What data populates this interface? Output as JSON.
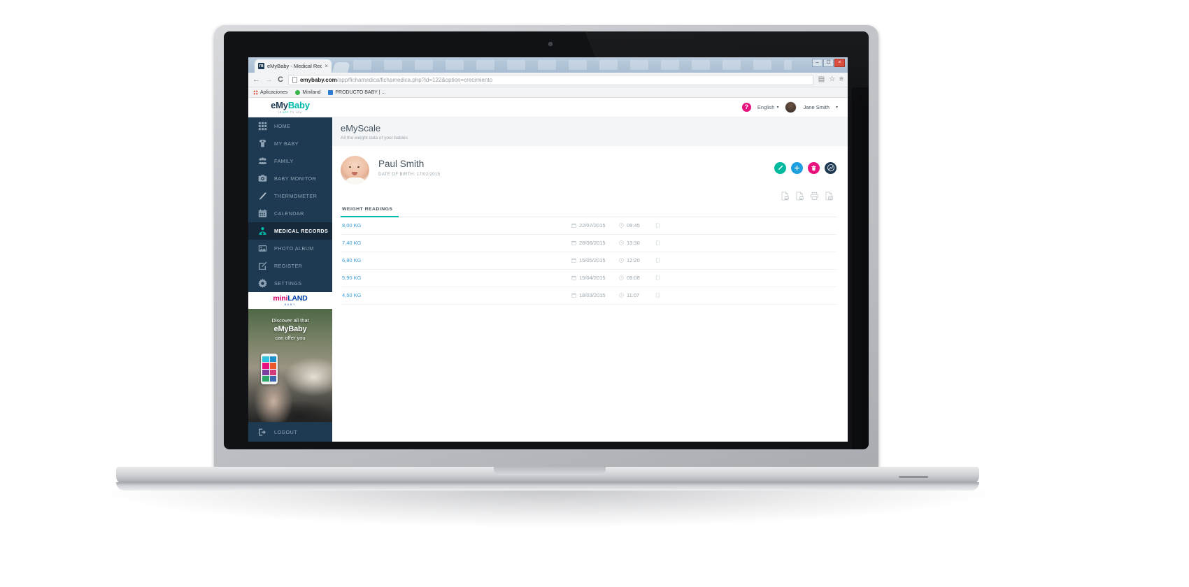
{
  "browser": {
    "tab": {
      "title": "eMyBaby - Medical Reco",
      "favicon": "m",
      "close": "×"
    },
    "window_controls": {
      "minimize": "–",
      "maximize": "☐",
      "close": "×"
    },
    "nav": {
      "back": "←",
      "forward": "→",
      "reload": "C"
    },
    "omnibox": {
      "domain": "emybaby.com",
      "path": "/app/fichamedica/fichamedica.php?id=122&option=crecimiento"
    },
    "toolbar_right": {
      "star": "☆",
      "extension": "▤",
      "menu": "≡"
    },
    "bookmarks": [
      {
        "label": "Aplicaciones",
        "icon": "apps-grid-icon"
      },
      {
        "label": "Miniland",
        "icon": "miniland-icon"
      },
      {
        "label": "PRODUCTO BABY | ...",
        "icon": "document-icon"
      }
    ]
  },
  "app": {
    "brand": {
      "name_a": "eMy",
      "name_b": "Baby",
      "tagline_a": "IS ",
      "tagline_b": "APP",
      "tagline_c": " TO YOU"
    },
    "topbar": {
      "help": "?",
      "language": "English",
      "caret": "▾",
      "user_name": "Jane Smith"
    },
    "sidebar": {
      "items": [
        {
          "label": "HOME",
          "icon": "grid-icon",
          "active": false
        },
        {
          "label": "MY BABY",
          "icon": "onesie-icon",
          "active": false
        },
        {
          "label": "FAMILY",
          "icon": "people-icon",
          "active": false
        },
        {
          "label": "BABY MONITOR",
          "icon": "camera-icon",
          "active": false
        },
        {
          "label": "THERMOMETER",
          "icon": "thermometer-icon",
          "active": false
        },
        {
          "label": "CALENDAR",
          "icon": "calendar-icon",
          "active": false
        },
        {
          "label": "MEDICAL RECORDS",
          "icon": "doctor-icon",
          "active": true
        },
        {
          "label": "PHOTO ALBUM",
          "icon": "photo-icon",
          "active": false
        },
        {
          "label": "REGISTER",
          "icon": "pencil-square-icon",
          "active": false
        },
        {
          "label": "SETTINGS",
          "icon": "gear-icon",
          "active": false
        }
      ],
      "miniland": {
        "word_a": "mini",
        "word_b": "LAND",
        "sub": "BABY"
      },
      "promo": {
        "line1": "Discover all that",
        "line2": "eMyBaby",
        "line3": "can offer you"
      },
      "logout": {
        "label": "LOGOUT",
        "icon": "logout-icon"
      }
    },
    "page": {
      "title": "eMyScale",
      "subtitle": "All the weight data of your babies"
    },
    "profile": {
      "name": "Paul Smith",
      "dob_label": "DATE OF BIRTH: 17/02/2015",
      "avatar": "baby-photo"
    },
    "action_buttons": [
      {
        "name": "edit-button",
        "icon": "pencil-icon",
        "color": "#00b99f",
        "glyph": "edit"
      },
      {
        "name": "add-button",
        "icon": "plus-icon",
        "color": "#1f9fe0",
        "glyph": "plus"
      },
      {
        "name": "delete-button",
        "icon": "trash-icon",
        "color": "#e8127e",
        "glyph": "trash"
      },
      {
        "name": "chart-button",
        "icon": "growth-chart-icon",
        "color": "#1e3a52",
        "glyph": "chart"
      }
    ],
    "export_buttons": [
      {
        "name": "export-csv-button",
        "icon": "file-csv-icon"
      },
      {
        "name": "export-excel-button",
        "icon": "file-excel-icon"
      },
      {
        "name": "print-button",
        "icon": "printer-icon"
      },
      {
        "name": "export-pdf-button",
        "icon": "file-pdf-icon"
      }
    ],
    "tabs": [
      {
        "label": "WEIGHT READINGS",
        "active": true
      }
    ],
    "table": {
      "rows": [
        {
          "weight": "8,00 KG",
          "date": "22/07/2015",
          "time": "09:45",
          "note": ""
        },
        {
          "weight": "7,40 KG",
          "date": "28/06/2015",
          "time": "13:30",
          "note": ""
        },
        {
          "weight": "6,80 KG",
          "date": "15/05/2015",
          "time": "12:20",
          "note": ""
        },
        {
          "weight": "5,90 KG",
          "date": "15/04/2015",
          "time": "09:08",
          "note": ""
        },
        {
          "weight": "4,50 KG",
          "date": "18/03/2015",
          "time": "11:07",
          "note": ""
        }
      ]
    }
  },
  "colors": {
    "sidebar_bg": "#1e3a52",
    "sidebar_active": "#16293a",
    "accent_teal": "#00b9a8",
    "accent_pink": "#e8127e",
    "accent_blue": "#1f9fe0",
    "link_blue": "#3b9fd6",
    "text_dark": "#44525c",
    "text_muted": "#9aa6ae"
  }
}
